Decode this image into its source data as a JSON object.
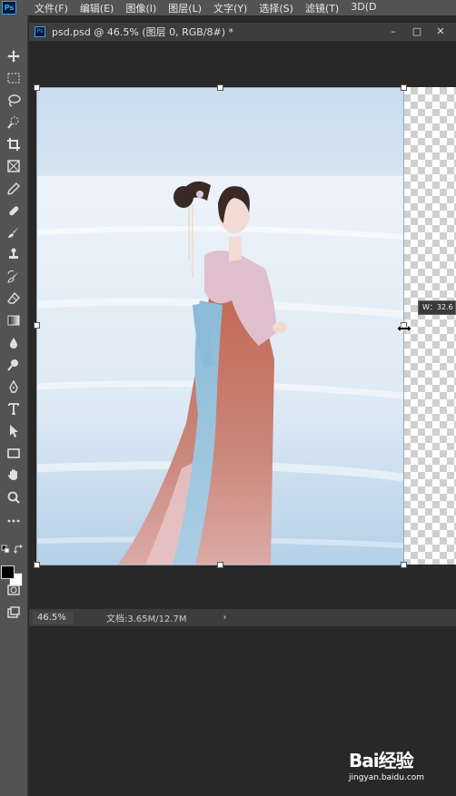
{
  "app": {
    "logo_text": "Ps"
  },
  "menu": [
    "文件(F)",
    "编辑(E)",
    "图像(I)",
    "图层(L)",
    "文字(Y)",
    "选择(S)",
    "滤镜(T)",
    "3D(D"
  ],
  "document": {
    "tab_icon": "Ps",
    "title": "psd.psd @ 46.5% (图层 0, RGB/8#) *"
  },
  "window_controls": {
    "minimize": "–",
    "restore": "▢",
    "close": "✕"
  },
  "tools": [
    "move-icon",
    "marquee-icon",
    "lasso-icon",
    "quick-select-icon",
    "crop-icon",
    "frame-icon",
    "eyedropper-icon",
    "healing-icon",
    "brush-icon",
    "stamp-icon",
    "history-brush-icon",
    "eraser-icon",
    "gradient-icon",
    "blur-icon",
    "dodge-icon",
    "pen-icon",
    "type-icon",
    "path-select-icon",
    "rectangle-icon",
    "hand-icon",
    "zoom-icon",
    "more-icon"
  ],
  "transform_tooltip": "W：32.6",
  "status": {
    "zoom": "46.5%",
    "doc_info": "文档:3.65M/12.7M",
    "arrow": "›"
  },
  "watermark": {
    "brand": "Bai经验",
    "url": "jingyan.baidu.com"
  },
  "colors": {
    "foreground": "#000000",
    "background": "#ffffff"
  }
}
